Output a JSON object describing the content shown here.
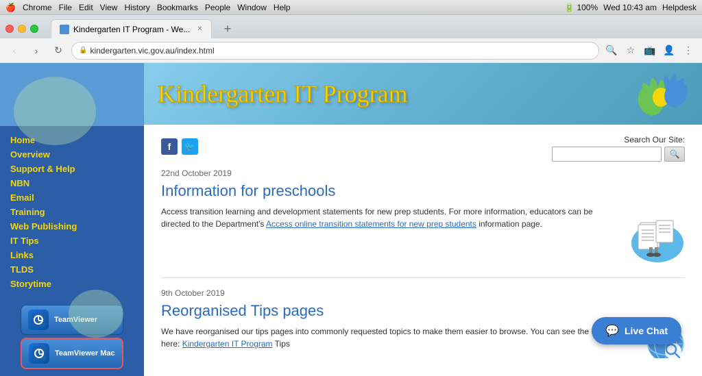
{
  "os": {
    "apple": "🍎",
    "menu_items": [
      "Chrome",
      "File",
      "Edit",
      "View",
      "History",
      "Bookmarks",
      "People",
      "Window",
      "Help"
    ],
    "right_items": [
      "100%",
      "Wed 10:43 am",
      "Helpdesk"
    ],
    "battery": "100%",
    "time": "Wed 10:43 am"
  },
  "browser": {
    "tab_title": "Kindergarten IT Program - We...",
    "url": "kindergarten.vic.gov.au/index.html"
  },
  "header": {
    "title": "Kindergarten IT Program"
  },
  "sidebar": {
    "nav_items": [
      {
        "label": "Home",
        "url": "#"
      },
      {
        "label": "Overview",
        "url": "#"
      },
      {
        "label": "Support & Help",
        "url": "#"
      },
      {
        "label": "NBN",
        "url": "#"
      },
      {
        "label": "Email",
        "url": "#"
      },
      {
        "label": "Training",
        "url": "#"
      },
      {
        "label": "Web Publishing",
        "url": "#"
      },
      {
        "label": "IT Tips",
        "url": "#"
      },
      {
        "label": "Links",
        "url": "#"
      },
      {
        "label": "TLDS",
        "url": "#"
      },
      {
        "label": "Storytime",
        "url": "#"
      }
    ],
    "teamviewer_label": "TeamViewer",
    "teamviewer_mac_label": "TeamViewer Mac"
  },
  "search": {
    "label": "Search Our Site:",
    "placeholder": "",
    "button_label": "q"
  },
  "articles": [
    {
      "date": "22nd October 2019",
      "title": "Information for preschools",
      "body": "Access transition learning and development statements for new prep students. For more information, educators can be directed to the Department's ",
      "link_text": "Access online transition statements for new prep students",
      "body_end": " information page."
    },
    {
      "date": "9th October 2019",
      "title": "Reorganised Tips pages",
      "body": "We have reorganised our tips pages into commonly requested topics to make them easier to browse. You can see the changes here: ",
      "link_text": "Kindergarten IT Program",
      "body_end": " Tips"
    }
  ],
  "chat": {
    "label": "Live Chat",
    "icon": "💬"
  }
}
